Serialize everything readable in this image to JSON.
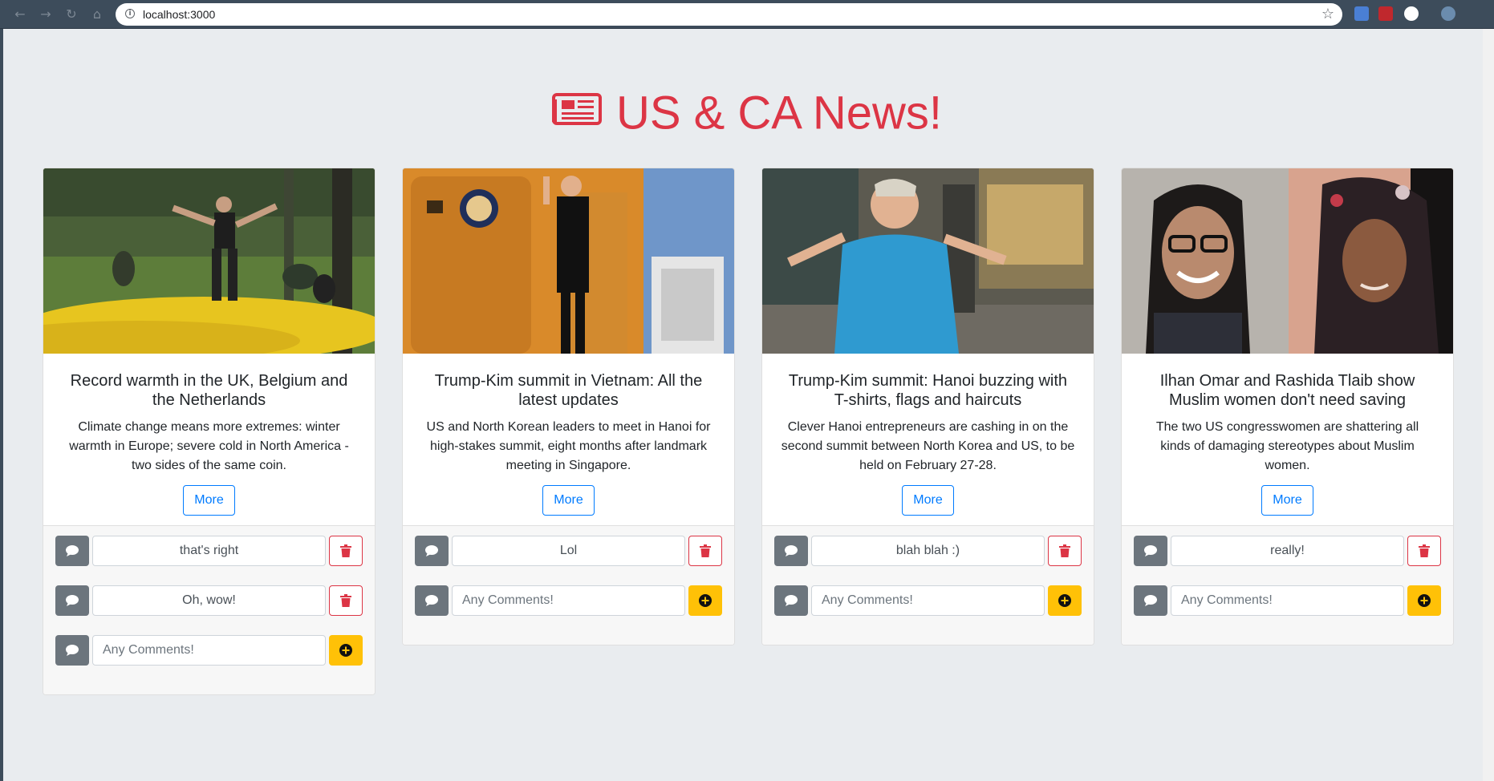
{
  "browser": {
    "url": "localhost:3000"
  },
  "page": {
    "title": "US & CA News!",
    "accent_color": "#dc3545",
    "link_color": "#007bff",
    "add_color": "#ffc107"
  },
  "cards": [
    {
      "title": "Record warmth in the UK, Belgium and the Netherlands",
      "text": "Climate change means more extremes: winter warmth in Europe; severe cold in North America - two sides of the same coin.",
      "more": "More",
      "comments": [
        "that's right",
        "Oh, wow!"
      ],
      "placeholder": "Any Comments!"
    },
    {
      "title": "Trump-Kim summit in Vietnam: All the latest updates",
      "text": "US and North Korean leaders to meet in Hanoi for high-stakes summit, eight months after landmark meeting in Singapore.",
      "more": "More",
      "comments": [
        "Lol"
      ],
      "placeholder": "Any Comments!"
    },
    {
      "title": "Trump-Kim summit: Hanoi buzzing with T-shirts, flags and haircuts",
      "text": "Clever Hanoi entrepreneurs are cashing in on the second summit between North Korea and US, to be held on February 27-28.",
      "more": "More",
      "comments": [
        "blah blah :)"
      ],
      "placeholder": "Any Comments!"
    },
    {
      "title": "Ilhan Omar and Rashida Tlaib show Muslim women don't need saving",
      "text": "The two US congresswomen are shattering all kinds of damaging stereotypes about Muslim women.",
      "more": "More",
      "comments": [
        "really!"
      ],
      "placeholder": "Any Comments!"
    }
  ]
}
